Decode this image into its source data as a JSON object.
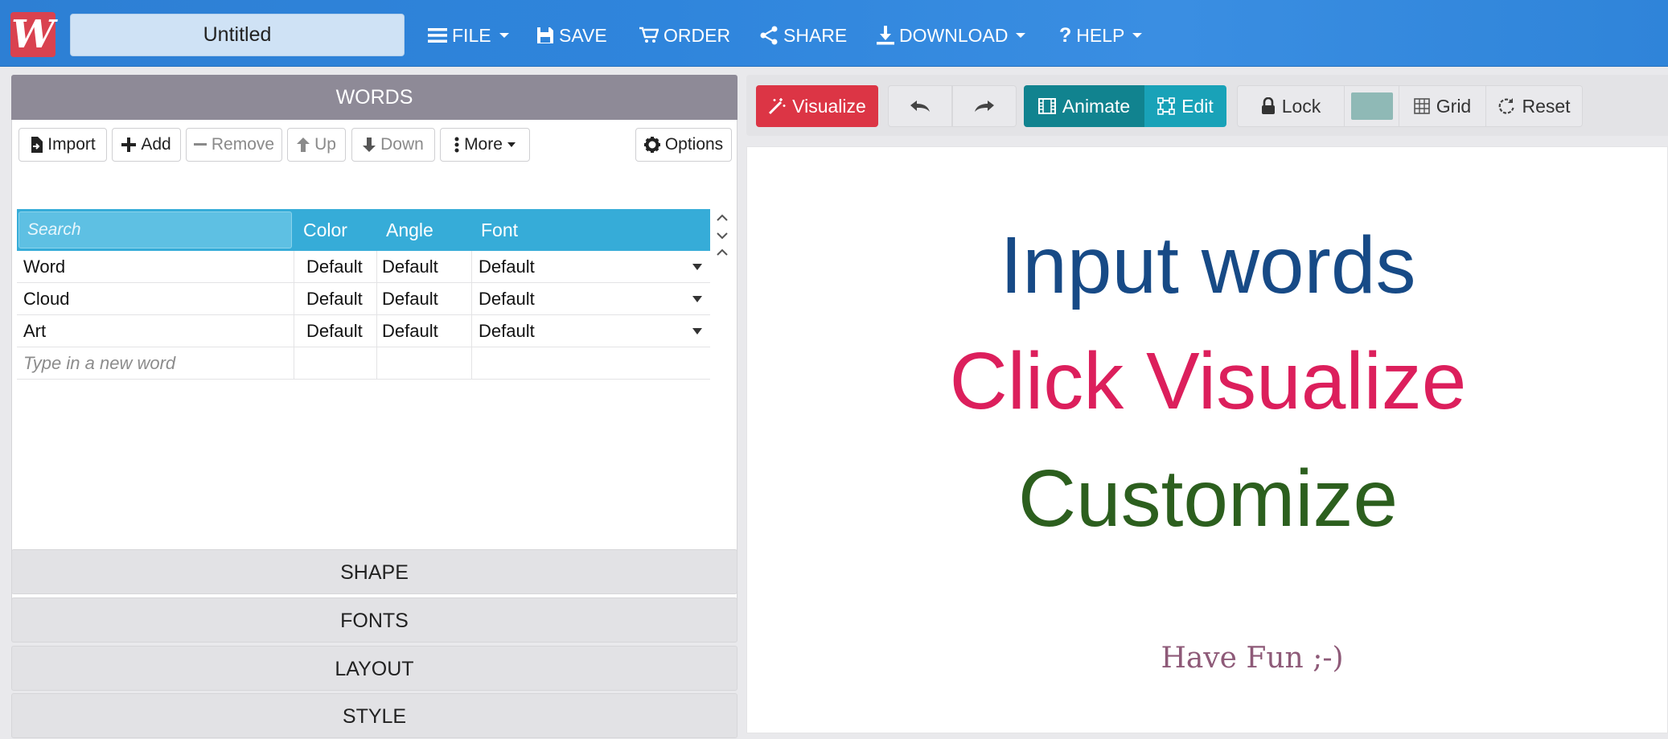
{
  "navbar": {
    "logo_letter": "W",
    "title": "Untitled",
    "file": "FILE",
    "save": "SAVE",
    "order": "ORDER",
    "share": "SHARE",
    "download": "DOWNLOAD",
    "help": "HELP"
  },
  "words_panel": {
    "heading": "WORDS",
    "toolbar": {
      "import": "Import",
      "add": "Add",
      "remove": "Remove",
      "up": "Up",
      "down": "Down",
      "more": "More",
      "options": "Options"
    },
    "columns": {
      "search_placeholder": "Search",
      "color": "Color",
      "angle": "Angle",
      "font": "Font"
    },
    "rows": [
      {
        "word": "Word",
        "color": "Default",
        "angle": "Default",
        "font": "Default"
      },
      {
        "word": "Cloud",
        "color": "Default",
        "angle": "Default",
        "font": "Default"
      },
      {
        "word": "Art",
        "color": "Default",
        "angle": "Default",
        "font": "Default"
      }
    ],
    "new_word_placeholder": "Type in a new word"
  },
  "accordion": {
    "shape": "SHAPE",
    "fonts": "FONTS",
    "layout": "LAYOUT",
    "style": "STYLE"
  },
  "canvas_toolbar": {
    "visualize": "Visualize",
    "animate": "Animate",
    "edit": "Edit",
    "lock": "Lock",
    "grid": "Grid",
    "reset": "Reset",
    "swatch_color": "#8fb9b6"
  },
  "canvas": {
    "line1": "Input words",
    "line2": "Click Visualize",
    "line3": "Customize",
    "line4": "Have Fun ;-)",
    "colors": {
      "line1": "#174a86",
      "line2": "#dc1f5c",
      "line3": "#2c5f1e",
      "line4": "#8e5a78"
    }
  },
  "colors": {
    "navbar": "#2f84d9",
    "visualize_btn": "#dc3545",
    "animate_btn": "#11838f",
    "edit_btn": "#19a2b8",
    "grid_header": "#36acd8"
  }
}
